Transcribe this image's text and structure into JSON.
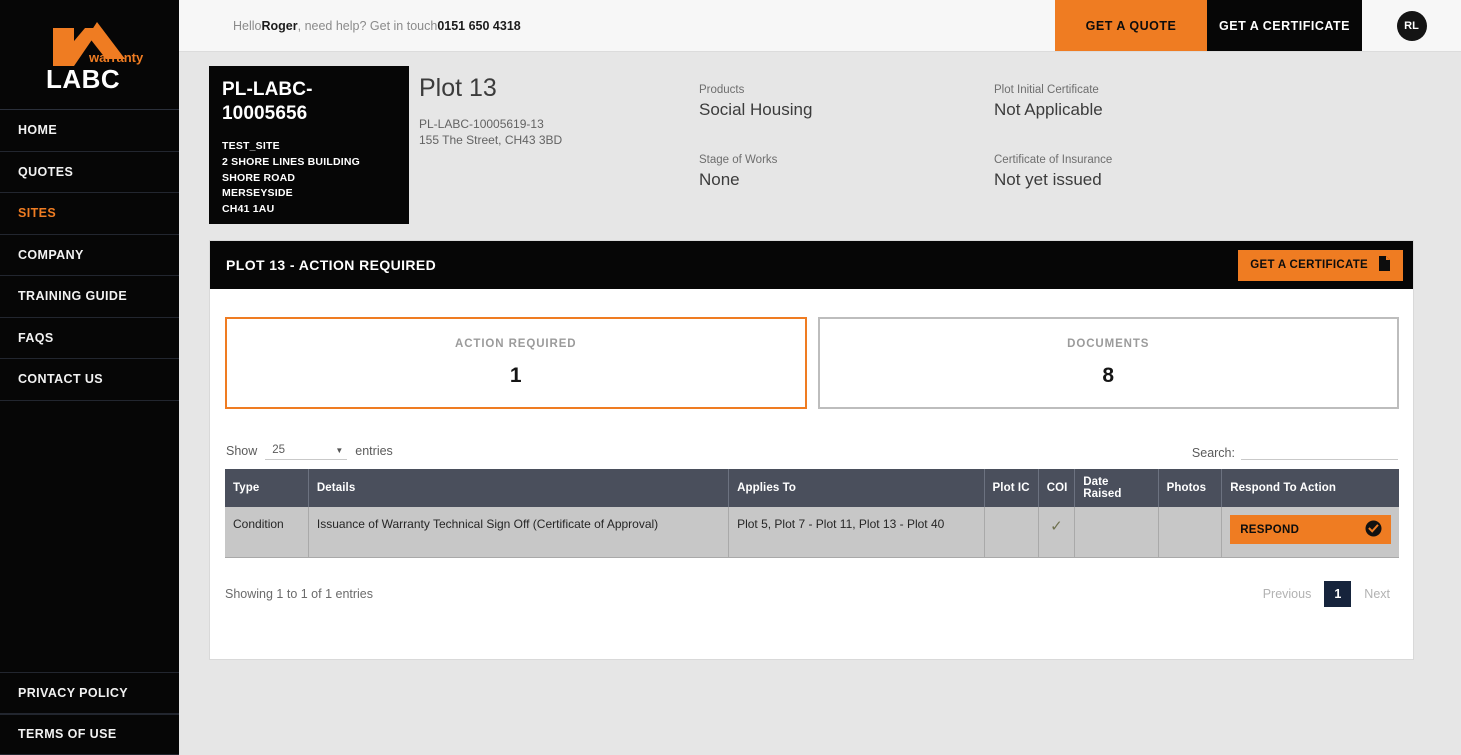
{
  "brand": {
    "logo_name": "labc-warranty-logo",
    "logo_word_warranty": "warranty",
    "logo_word_labc": "LABC",
    "accent_color": "#ef7c22",
    "dark_color": "#060606"
  },
  "sidebar": {
    "items": [
      {
        "label": "HOME",
        "active": false
      },
      {
        "label": "QUOTES",
        "active": false
      },
      {
        "label": "SITES",
        "active": true
      },
      {
        "label": "COMPANY",
        "active": false
      },
      {
        "label": "TRAINING GUIDE",
        "active": false
      },
      {
        "label": "FAQS",
        "active": false
      },
      {
        "label": "CONTACT US",
        "active": false
      }
    ],
    "bottom_items": [
      {
        "label": "PRIVACY POLICY"
      },
      {
        "label": "TERMS OF USE"
      }
    ]
  },
  "topbar": {
    "greeting_prefix": "Hello ",
    "user_name": "Roger",
    "greeting_middle": ", need help? Get in touch ",
    "phone": "0151 650 4318",
    "get_a_quote": "GET A QUOTE",
    "get_a_certificate": "GET A CERTIFICATE",
    "avatar_initials": "RL"
  },
  "summary": {
    "card_ref": "PL-LABC-10005656",
    "card_address": "TEST_SITE\n2 SHORE LINES BUILDING\nSHORE ROAD\nMERSEYSIDE\nCH41 1AU",
    "plot_title": "Plot 13",
    "plot_ref": "PL-LABC-10005619-13",
    "plot_address": "155 The Street, CH43 3BD",
    "meta": [
      {
        "label": "Products",
        "value": "Social Housing"
      },
      {
        "label": "Plot Initial Certificate",
        "value": "Not Applicable"
      },
      {
        "label": "Stage of Works",
        "value": "None"
      },
      {
        "label": "Certificate of Insurance",
        "value": "Not yet issued"
      }
    ]
  },
  "panel": {
    "title": "PLOT 13 - ACTION REQUIRED",
    "cert_button": "GET A CERTIFICATE",
    "cert_button_icon": "document-icon",
    "stats": [
      {
        "label": "ACTION REQUIRED",
        "value": "1",
        "active": true
      },
      {
        "label": "DOCUMENTS",
        "value": "8",
        "active": false
      }
    ],
    "controls": {
      "show_label": "Show",
      "entries_value": "25",
      "entries_label": "entries",
      "search_label": "Search:",
      "search_value": "",
      "search_placeholder": ""
    },
    "table": {
      "columns": [
        "Type",
        "Details",
        "Applies To",
        "Plot IC",
        "COI",
        "Date Raised",
        "Photos",
        "Respond To Action"
      ],
      "rows": [
        {
          "type": "Condition",
          "details": "Issuance of Warranty Technical Sign Off (Certificate of Approval)",
          "applies_to": "Plot 5, Plot 7 - Plot 11, Plot 13 - Plot 40",
          "plot_ic": "",
          "coi": "✓",
          "date_raised": "",
          "photos": "",
          "respond_label": "RESPOND",
          "respond_icon": "check-circle-icon"
        }
      ]
    },
    "footer": {
      "showing": "Showing 1 to 1 of 1 entries",
      "previous": "Previous",
      "page": "1",
      "next": "Next"
    }
  }
}
